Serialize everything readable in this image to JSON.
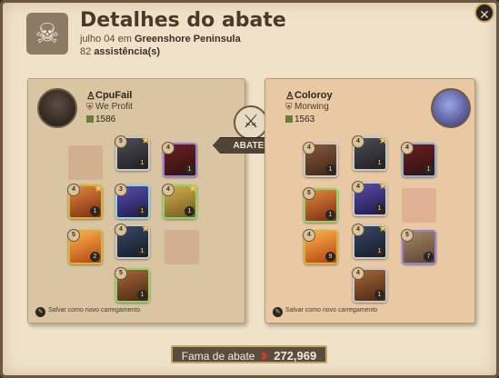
{
  "header": {
    "title": "Detalhes do abate",
    "date": "julho 04",
    "preposition": "em",
    "location": "Greenshore Peninsula",
    "assists_count": "82",
    "assists_label": "assistência(s)"
  },
  "center": {
    "killed_label": "ABATEU"
  },
  "killer": {
    "name": "CpuFail",
    "guild": "We Profit",
    "item_power": "1586",
    "save_label": "Salvar como novo carregamento",
    "slots": [
      {
        "slot": "head",
        "tier": "5",
        "qty": "1",
        "enchanted": true,
        "rarity_color": "#c9c9c9"
      },
      {
        "slot": "cape",
        "tier": "4",
        "qty": "1",
        "enchanted": false,
        "rarity_color": "#9b7cd6"
      },
      {
        "slot": "main-hand",
        "tier": "4",
        "qty": "1",
        "enchanted": true,
        "rarity_color": "#d9b23c"
      },
      {
        "slot": "chest",
        "tier": "3",
        "qty": "1",
        "enchanted": false,
        "rarity_color": "#8fd4e6"
      },
      {
        "slot": "off-hand",
        "tier": "4",
        "qty": "1",
        "enchanted": true,
        "rarity_color": "#8fd46b"
      },
      {
        "slot": "potion",
        "tier": "5",
        "qty": "2",
        "enchanted": false,
        "rarity_color": "#d9b23c"
      },
      {
        "slot": "boots",
        "tier": "4",
        "qty": "1",
        "enchanted": true,
        "rarity_color": "#c9c9c9"
      },
      {
        "slot": "mount",
        "tier": "5",
        "qty": "1",
        "enchanted": false,
        "rarity_color": "#8fd46b"
      }
    ]
  },
  "victim": {
    "name": "Coloroy",
    "guild": "Morwing",
    "item_power": "1563",
    "save_label": "Salvar como novo carregamento",
    "slots": [
      {
        "slot": "bag",
        "tier": "4",
        "qty": "1",
        "enchanted": false,
        "rarity_color": "#c9c9c9"
      },
      {
        "slot": "head",
        "tier": "4",
        "qty": "1",
        "enchanted": true,
        "rarity_color": "#c9c9c9"
      },
      {
        "slot": "cape",
        "tier": "4",
        "qty": "1",
        "enchanted": false,
        "rarity_color": "#8fb2d8"
      },
      {
        "slot": "main-hand",
        "tier": "5",
        "qty": "1",
        "enchanted": false,
        "rarity_color": "#8fd46b"
      },
      {
        "slot": "chest",
        "tier": "4",
        "qty": "1",
        "enchanted": true,
        "rarity_color": "#c9c9c9"
      },
      {
        "slot": "potion",
        "tier": "4",
        "qty": "9",
        "enchanted": false,
        "rarity_color": "#d9b23c"
      },
      {
        "slot": "boots",
        "tier": "4",
        "qty": "1",
        "enchanted": true,
        "rarity_color": "#c9c9c9"
      },
      {
        "slot": "food",
        "tier": "5",
        "qty": "7",
        "enchanted": false,
        "rarity_color": "#9b7cd6"
      },
      {
        "slot": "mount",
        "tier": "4",
        "qty": "1",
        "enchanted": false,
        "rarity_color": "#c9c9c9"
      }
    ]
  },
  "footer": {
    "fame_label": "Fama de abate",
    "fame_value": "272,969"
  },
  "colors": {
    "accent": "#c6a667",
    "parchment": "#efe2c9",
    "fame_drop": "#d23a2a"
  }
}
